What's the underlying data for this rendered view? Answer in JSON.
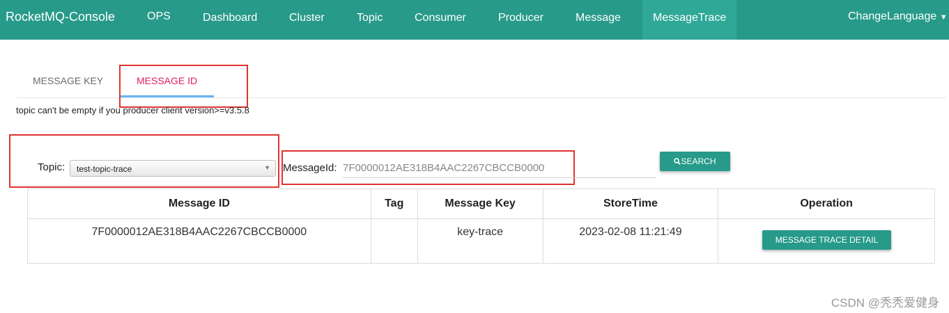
{
  "navbar": {
    "brand": "RocketMQ-Console",
    "items": [
      "OPS",
      "Dashboard",
      "Cluster",
      "Topic",
      "Consumer",
      "Producer",
      "Message",
      "MessageTrace"
    ],
    "active": "MessageTrace",
    "language": "ChangeLanguage",
    "color": "#279a8a"
  },
  "tabs": {
    "message_key": "MESSAGE KEY",
    "message_id": "MESSAGE ID",
    "active": "MESSAGE ID"
  },
  "note": "topic can't be empty if you producer client version>=v3.5.8",
  "form": {
    "topic_label": "Topic:",
    "topic_value": "test-topic-trace",
    "messageid_label": "MessageId:",
    "messageid_value": "7F0000012AE318B4AAC2267CBCCB0000",
    "search_label": "SEARCH",
    "search_icon": "search-icon"
  },
  "table": {
    "headers": [
      "Message ID",
      "Tag",
      "Message Key",
      "StoreTime",
      "Operation"
    ],
    "rows": [
      {
        "message_id": "7F0000012AE318B4AAC2267CBCCB0000",
        "tag": "",
        "message_key": "key-trace",
        "store_time": "2023-02-08 11:21:49",
        "operation": "MESSAGE TRACE DETAIL"
      }
    ]
  },
  "watermark": "CSDN @秃秃爱健身"
}
